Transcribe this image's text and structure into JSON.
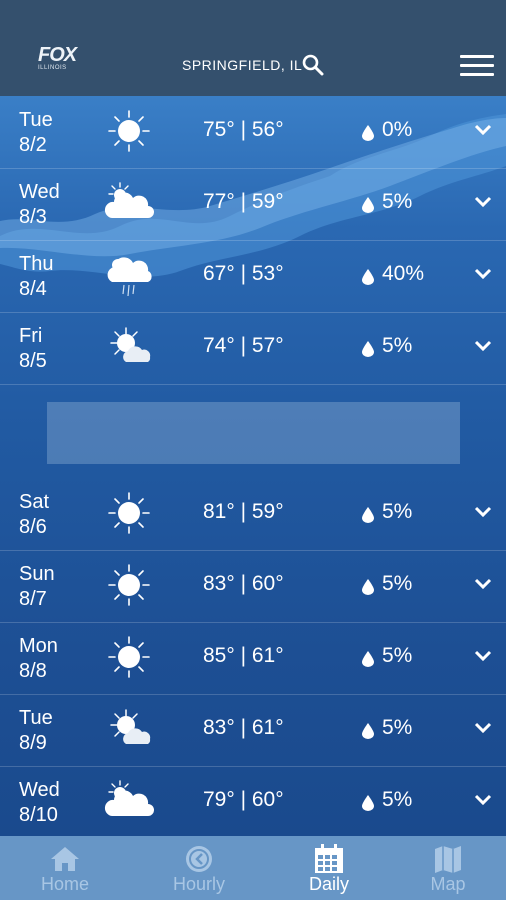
{
  "header": {
    "logo_main": "FOX",
    "logo_sub": "ILLINOIS",
    "location": "SPRINGFIELD, IL",
    "icons": [
      "search-icon",
      "hamburger-menu-icon"
    ]
  },
  "days": [
    {
      "day": "Tue",
      "date": "8/2",
      "icon": "sunny",
      "temps": "75° | 56°",
      "precip": "0%"
    },
    {
      "day": "Wed",
      "date": "8/3",
      "icon": "cloudy",
      "temps": "77° | 59°",
      "precip": "5%"
    },
    {
      "day": "Thu",
      "date": "8/4",
      "icon": "rain",
      "temps": "67° | 53°",
      "precip": "40%"
    },
    {
      "day": "Fri",
      "date": "8/5",
      "icon": "partly-cloudy",
      "temps": "74° | 57°",
      "precip": "5%"
    },
    {
      "day": "Sat",
      "date": "8/6",
      "icon": "sunny",
      "temps": "81° | 59°",
      "precip": "5%"
    },
    {
      "day": "Sun",
      "date": "8/7",
      "icon": "sunny",
      "temps": "83° | 60°",
      "precip": "5%"
    },
    {
      "day": "Mon",
      "date": "8/8",
      "icon": "sunny",
      "temps": "85° | 61°",
      "precip": "5%"
    },
    {
      "day": "Tue",
      "date": "8/9",
      "icon": "partly-cloudy",
      "temps": "83° | 61°",
      "precip": "5%"
    },
    {
      "day": "Wed",
      "date": "8/10",
      "icon": "cloudy",
      "temps": "79° | 60°",
      "precip": "5%"
    }
  ],
  "tabs": [
    {
      "label": "Home",
      "icon": "home-icon",
      "active": false
    },
    {
      "label": "Hourly",
      "icon": "clock-icon",
      "active": false
    },
    {
      "label": "Daily",
      "icon": "calendar-icon",
      "active": true
    },
    {
      "label": "Map",
      "icon": "map-icon",
      "active": false
    }
  ],
  "colors": {
    "header": "#34506d",
    "tabbar": "#6796c6",
    "list_top": "#3a7fc7",
    "list_bottom": "#1a4a8d"
  }
}
